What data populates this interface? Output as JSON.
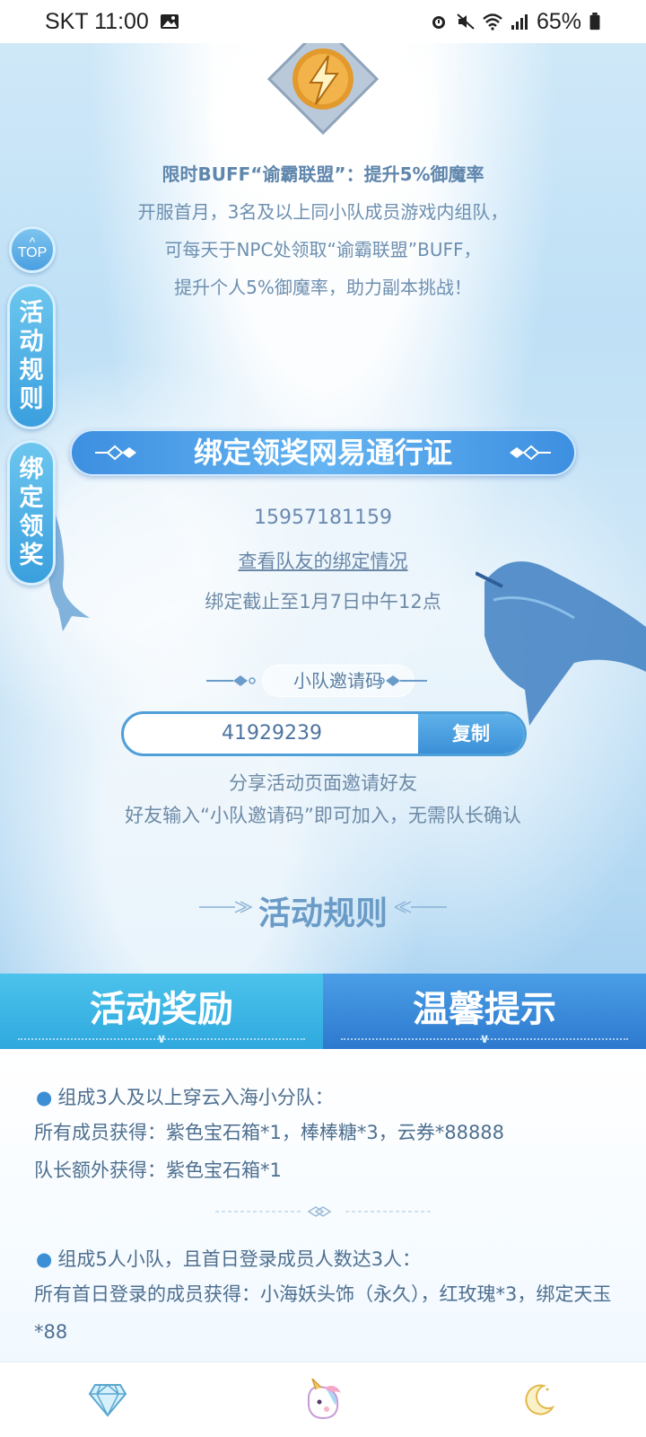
{
  "status_bar": {
    "carrier_time": "SKT 11:00",
    "battery": "65%",
    "icons": [
      "image-icon",
      "alarm-icon",
      "mute-icon",
      "wifi-icon",
      "signal-icon",
      "battery-icon"
    ]
  },
  "buff": {
    "title": "限时BUFF“谕霸联盟”：提升5%御魔率",
    "lines": [
      "开服首月，3名及以上同小队成员游戏内组队，",
      "可每天于NPC处领取“谕霸联盟”BUFF，",
      "提升个人5%御魔率，助力副本挑战！"
    ]
  },
  "side_nav": {
    "top_label": "TOP",
    "rules_tab": [
      "活",
      "动",
      "规",
      "则"
    ],
    "bind_tab": [
      "绑",
      "定",
      "领",
      "奖"
    ]
  },
  "bind": {
    "banner": "绑定领奖网易通行证",
    "phone": "15957181159",
    "teammates_link": "查看队友的绑定情况",
    "deadline": "绑定截止至1月7日中午12点"
  },
  "invite": {
    "label": "小队邀请码",
    "code": "41929239",
    "copy_button": "复制",
    "share_line": "分享活动页面邀请好友",
    "hint_line": "好友输入“小队邀请码”即可加入，无需队长确认"
  },
  "rules": {
    "title": "活动规则"
  },
  "tabs": [
    {
      "label": "活动奖励",
      "active": true
    },
    {
      "label": "温馨提示",
      "active": false
    }
  ],
  "rewards": [
    {
      "head": "组成3人及以上穿云入海小分队：",
      "lines": [
        "所有成员获得：紫色宝石箱*1，棒棒糖*3，云券*88888",
        "队长额外获得：紫色宝石箱*1"
      ]
    },
    {
      "head": "组成5人小队，且首日登录成员人数达3人：",
      "lines": [
        "所有首日登录的成员获得：小海妖头饰（永久），红玫瑰*3，绑定天玉*88"
      ]
    }
  ],
  "bottom_nav": [
    "diamond-icon",
    "unicorn-icon",
    "moon-icon"
  ],
  "colors": {
    "accent_blue": "#3d8fe0",
    "tab_cyan": "#2fa8de",
    "text_blue_gray": "#6d8fb0"
  }
}
